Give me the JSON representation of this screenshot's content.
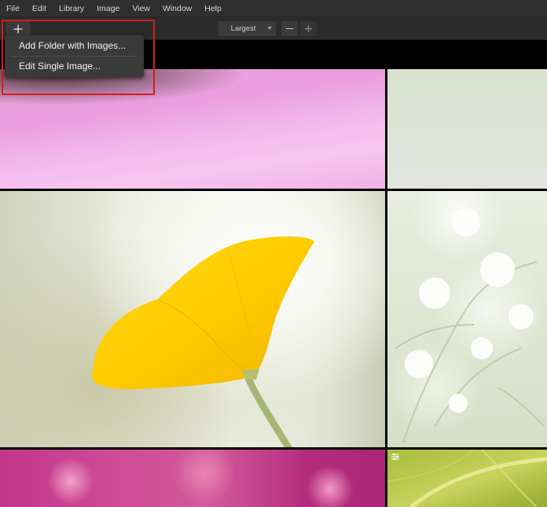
{
  "menubar": {
    "items": [
      "File",
      "Edit",
      "Library",
      "Image",
      "View",
      "Window",
      "Help"
    ]
  },
  "toolbar": {
    "add_icon": "plus-icon",
    "thumbnail_size": "Largest",
    "zoom_out_icon": "minus-icon",
    "zoom_in_icon": "plus-icon"
  },
  "add_menu": {
    "items": [
      "Add Folder with Images...",
      "Edit Single Image..."
    ]
  },
  "library": {
    "thumbnails": [
      {
        "subject": "pink petal",
        "edited": false
      },
      {
        "subject": "pale green",
        "edited": false
      },
      {
        "subject": "yellow poppy",
        "edited": false
      },
      {
        "subject": "white flowers",
        "edited": false
      },
      {
        "subject": "magenta flowers",
        "edited": false
      },
      {
        "subject": "green leaf",
        "edited": true
      }
    ],
    "edited_icon": "adjustments-icon"
  },
  "colors": {
    "highlight": "#d21e1e",
    "menu_bg": "#3a3a3a",
    "toolbar_bg": "#2b2b2b"
  }
}
